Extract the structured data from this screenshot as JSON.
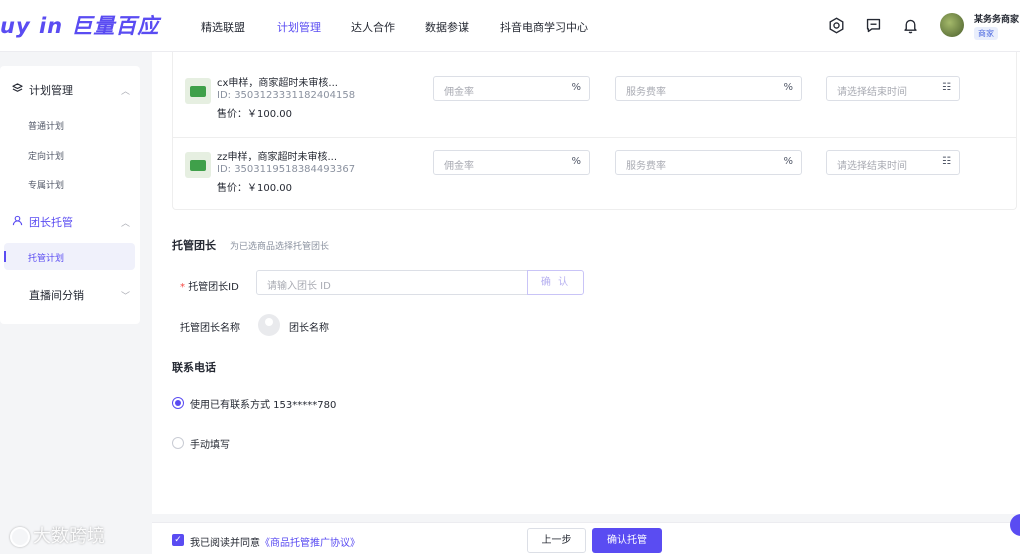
{
  "header": {
    "logo": "uy in 巨量百应",
    "nav": [
      "精选联盟",
      "计划管理",
      "达人合作",
      "数据参谋",
      "抖音电商学习中心"
    ],
    "active_nav": "计划管理",
    "icons": [
      "settings-icon",
      "message-icon",
      "bell-icon"
    ],
    "user": {
      "name": "某务务商家",
      "badge": "商家"
    }
  },
  "sidebar": {
    "groups": [
      {
        "label": "计划管理",
        "icon": "layers-icon",
        "items": [
          "普通计划",
          "定向计划",
          "专属计划"
        ]
      },
      {
        "label": "团长托管",
        "icon": "user-group-icon",
        "items": [
          "托管计划"
        ]
      },
      {
        "label": "直播间分销",
        "items": []
      }
    ],
    "active_item": "托管计划"
  },
  "products": [
    {
      "title": "cx申样，商家超时未审核...",
      "id": "ID: 3503123331182404158",
      "price": "售价：￥100.00"
    },
    {
      "title": "zz申样，商家超时未审核...",
      "id": "ID: 3503119518384493367",
      "price": "售价：￥100.00"
    }
  ],
  "inputs": {
    "commission_placeholder": "佣金率",
    "service_placeholder": "服务费率",
    "end_time_placeholder": "请选择结束时间",
    "percent": "%"
  },
  "leader_section": {
    "title": "托管团长",
    "subtitle": "为已选商品选择托管团长",
    "id_label": "托管团长ID",
    "required_mark": "*",
    "id_placeholder": "请输入团长 ID",
    "confirm": "确 认",
    "name_label": "托管团长名称",
    "name_value": "团长名称"
  },
  "contact": {
    "title": "联系电话",
    "options": [
      "使用已有联系方式 153*****780",
      "手动填写"
    ],
    "selected": 0
  },
  "footer": {
    "agree_text": "我已阅读并同意",
    "agreement_link": "《商品托管推广协议》",
    "prev": "上一步",
    "submit": "确认托管"
  },
  "watermark": "大数跨境"
}
